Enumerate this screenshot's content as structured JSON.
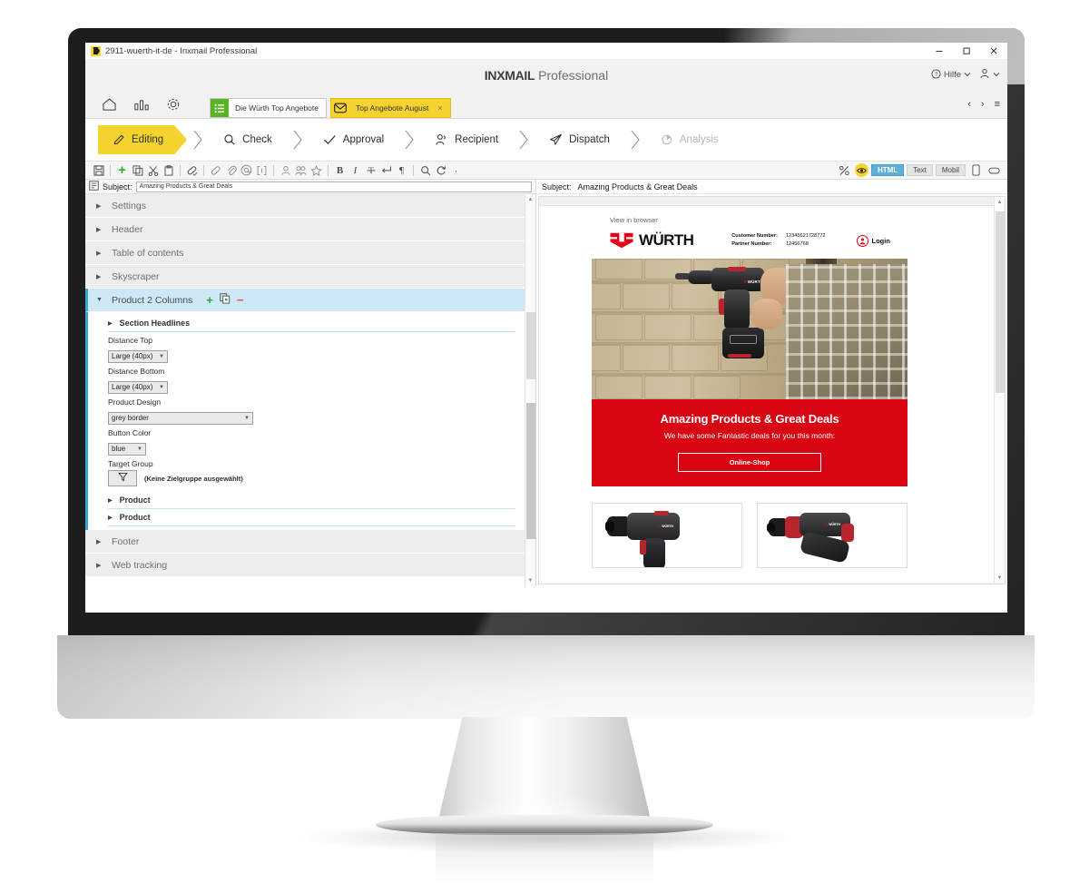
{
  "window": {
    "title": "2911-wuerth-it-de - Inxmail Professional",
    "app_badge": "inxmail-logo",
    "controls": {
      "minimize": "minimize",
      "maximize": "maximize",
      "close": "close"
    }
  },
  "header": {
    "brand_bold": "INXMAIL",
    "brand_rest": "Professional",
    "help_label": "Hilfe",
    "help_icon": "question-circle-icon",
    "help_caret": "chevron-down-icon",
    "user_icon": "user-icon",
    "user_caret": "chevron-down-icon"
  },
  "nav": {
    "icons": [
      {
        "name": "home-icon",
        "label": "Home"
      },
      {
        "name": "statistics-icon",
        "label": "Statistics"
      },
      {
        "name": "settings-gear-icon",
        "label": "Settings"
      }
    ],
    "tabs": [
      {
        "label": "Die Würth Top Angebote",
        "icon": "list-icon",
        "active": false,
        "closable": false
      },
      {
        "label": "Top Angebote August",
        "icon": "mail-icon",
        "active": true,
        "closable": true,
        "close_glyph": "×"
      }
    ],
    "right_controls": [
      {
        "name": "prev-arrow",
        "glyph": "‹"
      },
      {
        "name": "next-arrow",
        "glyph": "›"
      },
      {
        "name": "hamburger-menu",
        "glyph": "≡"
      }
    ]
  },
  "workflow": {
    "steps": [
      {
        "label": "Editing",
        "icon": "pencil-icon",
        "state": "active"
      },
      {
        "label": "Check",
        "icon": "magnifier-icon",
        "state": "enabled"
      },
      {
        "label": "Approval",
        "icon": "checkmark-icon",
        "state": "enabled"
      },
      {
        "label": "Recipient",
        "icon": "person-icon",
        "state": "enabled"
      },
      {
        "label": "Dispatch",
        "icon": "paper-plane-icon",
        "state": "enabled"
      },
      {
        "label": "Analysis",
        "icon": "pie-chart-icon",
        "state": "disabled"
      }
    ],
    "separator": "›"
  },
  "toolbar": {
    "left_items": [
      {
        "name": "save-icon",
        "glyph": "save"
      },
      {
        "name": "separator",
        "glyph": "|"
      },
      {
        "name": "add-icon",
        "glyph": "+"
      },
      {
        "name": "copy-icon",
        "glyph": "copy"
      },
      {
        "name": "cut-icon",
        "glyph": "cut"
      },
      {
        "name": "paste-icon",
        "glyph": "paste"
      },
      {
        "name": "separator",
        "glyph": "|"
      },
      {
        "name": "link-check-icon",
        "glyph": "link-ok"
      },
      {
        "name": "separator",
        "glyph": "|"
      },
      {
        "name": "link-icon",
        "glyph": "link"
      },
      {
        "name": "attachment-icon",
        "glyph": "clip"
      },
      {
        "name": "at-icon",
        "glyph": "@"
      },
      {
        "name": "placeholder-icon",
        "glyph": "[]"
      },
      {
        "name": "separator",
        "glyph": "|"
      },
      {
        "name": "personalize-icon",
        "glyph": "person"
      },
      {
        "name": "target-group-icon",
        "glyph": "persons"
      },
      {
        "name": "favorite-icon",
        "glyph": "star"
      },
      {
        "name": "separator",
        "glyph": "|"
      },
      {
        "name": "bold-icon",
        "glyph": "B"
      },
      {
        "name": "italic-icon",
        "glyph": "I"
      },
      {
        "name": "strikethrough-icon",
        "glyph": "T"
      },
      {
        "name": "linebreak-icon",
        "glyph": "↵"
      },
      {
        "name": "paragraph-icon",
        "glyph": "¶"
      },
      {
        "name": "separator",
        "glyph": "|"
      },
      {
        "name": "search-icon",
        "glyph": "search"
      },
      {
        "name": "refresh-icon",
        "glyph": "refresh"
      },
      {
        "name": "more-icon",
        "glyph": "·"
      }
    ],
    "right_items": [
      {
        "name": "personalization-preview-icon",
        "label": "%"
      },
      {
        "name": "preview-eye-icon",
        "label": "eye",
        "highlighted": true
      },
      {
        "name": "view-html-button",
        "label": "HTML",
        "active": true
      },
      {
        "name": "view-text-button",
        "label": "Text",
        "active": false
      },
      {
        "name": "view-mobile-button",
        "label": "Mobil",
        "active": false
      },
      {
        "name": "device-phone-icon",
        "label": "phone"
      },
      {
        "name": "device-tablet-icon",
        "label": "tablet"
      }
    ]
  },
  "editor": {
    "subject_label": "Subject:",
    "subject_icon": "subject-field-icon",
    "subject_value": "Amazing Products & Great Deals",
    "subject_placeholder": "Subject",
    "sections": [
      {
        "id": "settings",
        "label": "Settings",
        "expanded": false,
        "selected": false
      },
      {
        "id": "header",
        "label": "Header",
        "expanded": false,
        "selected": false
      },
      {
        "id": "table-of-contents",
        "label": "Table of contents",
        "expanded": false,
        "selected": false
      },
      {
        "id": "skyscraper",
        "label": "Skyscraper",
        "expanded": false,
        "selected": false
      },
      {
        "id": "product-2-columns",
        "label": "Product 2 Columns",
        "expanded": true,
        "selected": true
      },
      {
        "id": "footer",
        "label": "Footer",
        "expanded": false,
        "selected": false
      },
      {
        "id": "web-tracking",
        "label": "Web tracking",
        "expanded": false,
        "selected": false
      }
    ],
    "section_actions": [
      {
        "name": "add-section-button",
        "glyph": "+"
      },
      {
        "name": "duplicate-section-button",
        "glyph": "copy"
      },
      {
        "name": "remove-section-button",
        "glyph": "−"
      }
    ],
    "product2col": {
      "section_headlines_label": "Section Headlines",
      "fields": [
        {
          "id": "distance-top",
          "label": "Distance Top",
          "value": "Large (40px)",
          "width": "small"
        },
        {
          "id": "distance-bottom",
          "label": "Distance Bottom",
          "value": "Large (40px)",
          "width": "small"
        },
        {
          "id": "product-design",
          "label": "Product Design",
          "value": "grey border",
          "width": "large"
        },
        {
          "id": "button-color",
          "label": "Button Color",
          "value": "blue",
          "width": "tiny"
        }
      ],
      "target_group": {
        "label": "Target Group",
        "button_icon": "filter-funnel-icon",
        "value": "(Keine Zielgruppe ausgewählt)"
      },
      "products": [
        {
          "label": "Product"
        },
        {
          "label": "Product"
        }
      ]
    }
  },
  "preview": {
    "subject_label": "Subject:",
    "subject_value": "Amazing Products & Great Deals",
    "email": {
      "view_in_browser": "View in browser",
      "logo_text": "WÜRTH",
      "logo_mark": "wurth-logo-icon",
      "customer_number_label": "Customer Number:",
      "customer_number_value": "12345621728772",
      "partner_number_label": "Partner Number:",
      "partner_number_value": "12456768",
      "login_label": "Login",
      "login_icon": "user-circle-icon",
      "hero_image_alt": "man-drilling-brick-wall-with-cordless-drill",
      "headline": "Amazing Products & Great Deals",
      "subheadline": "We have some Fantastic deals for you this month:",
      "cta_label": "Online-Shop",
      "products": [
        {
          "alt": "cordless-drill-driver-product-image"
        },
        {
          "alt": "rotary-hammer-drill-product-image"
        }
      ]
    }
  },
  "colors": {
    "brand_yellow": "#f5d32e",
    "wurth_red": "#d80613",
    "selected_blue": "#cfe8f7",
    "accent_blue": "#37a6d9",
    "toggle_blue": "#5fb0d8",
    "green": "#5cb226",
    "bezel_dark": "#1d1d1d"
  }
}
